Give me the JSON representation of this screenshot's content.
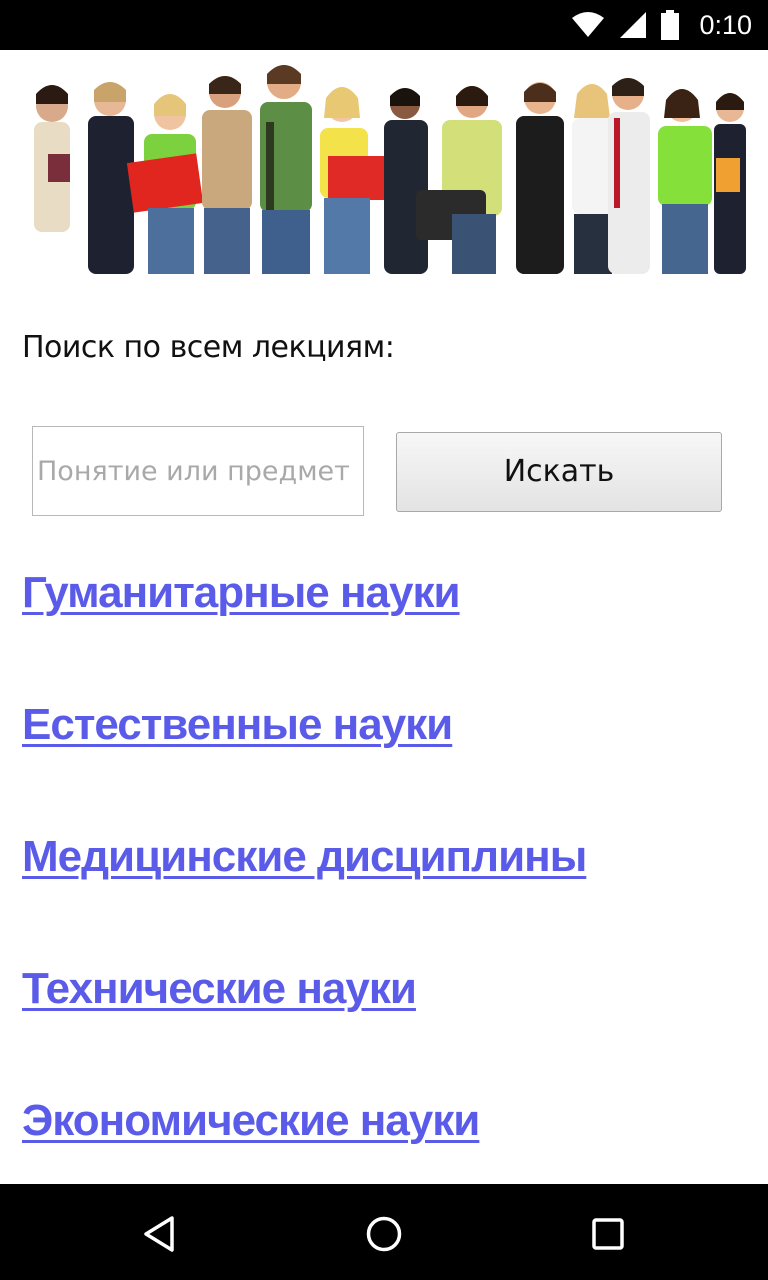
{
  "status_bar": {
    "time": "0:10",
    "icons": [
      "wifi-icon",
      "signal-icon",
      "battery-icon"
    ]
  },
  "banner": {
    "alt": "students-banner"
  },
  "search": {
    "label": "Поиск по всем лекциям:",
    "placeholder": "Понятие или предмет",
    "value": "",
    "button_label": "Искать"
  },
  "categories": [
    {
      "label": "Гуманитарные науки"
    },
    {
      "label": "Естественные науки"
    },
    {
      "label": "Медицинские дисциплины"
    },
    {
      "label": "Технические науки"
    },
    {
      "label": "Экономические науки"
    }
  ],
  "nav_bar": {
    "icons": [
      "back-icon",
      "home-icon",
      "recents-icon"
    ]
  },
  "colors": {
    "link": "#5b5bea",
    "status_bar": "#000000",
    "nav_bar": "#000000"
  }
}
